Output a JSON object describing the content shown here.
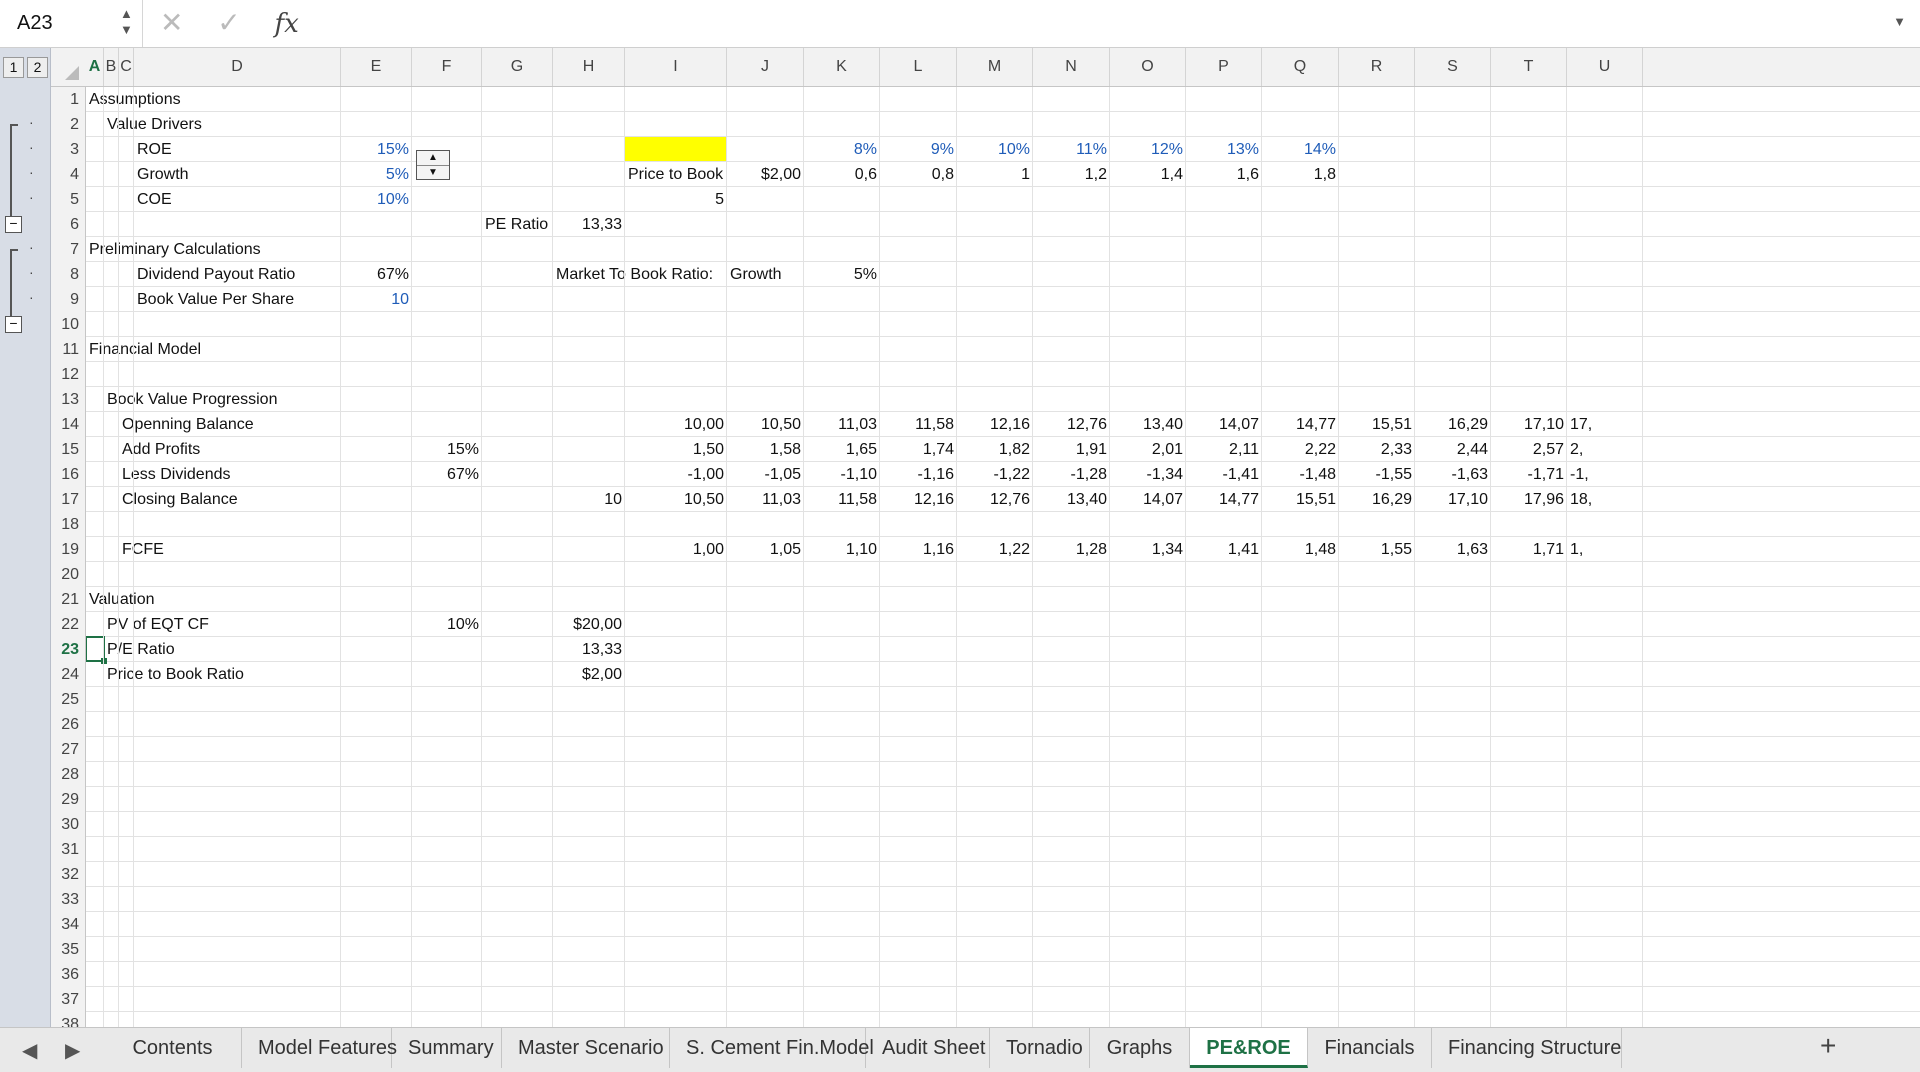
{
  "formula_bar": {
    "cell_ref": "A23",
    "cancel_icon": "✕",
    "enter_icon": "✓",
    "fx_label": "fx",
    "formula": ""
  },
  "outline": {
    "levels": [
      "1",
      "2"
    ]
  },
  "active": {
    "col": "A",
    "row": 23
  },
  "columns": [
    "A",
    "B",
    "C",
    "D",
    "E",
    "F",
    "G",
    "H",
    "I",
    "J",
    "K",
    "L",
    "M",
    "N",
    "O",
    "P",
    "Q",
    "R",
    "S",
    "T",
    "U"
  ],
  "rows": [
    1,
    2,
    3,
    4,
    5,
    6,
    7,
    8,
    9,
    10,
    11,
    12,
    13,
    14,
    15,
    16,
    17,
    18,
    19,
    20,
    21,
    22,
    23,
    24,
    25,
    26,
    27,
    28,
    29,
    30,
    31,
    32,
    33,
    34,
    35,
    36,
    37,
    38
  ],
  "cells": [
    {
      "row": 1,
      "col": "A",
      "text": "Assumptions"
    },
    {
      "row": 2,
      "col": "B",
      "text": "Value Drivers"
    },
    {
      "row": 3,
      "col": "D",
      "text": "ROE"
    },
    {
      "row": 3,
      "col": "E",
      "text": "15%",
      "align": "r",
      "color": "blue"
    },
    {
      "row": 3,
      "col": "K",
      "text": "8%",
      "align": "r",
      "color": "blue"
    },
    {
      "row": 3,
      "col": "L",
      "text": "9%",
      "align": "r",
      "color": "blue"
    },
    {
      "row": 3,
      "col": "M",
      "text": "10%",
      "align": "r",
      "color": "blue"
    },
    {
      "row": 3,
      "col": "N",
      "text": "11%",
      "align": "r",
      "color": "blue"
    },
    {
      "row": 3,
      "col": "O",
      "text": "12%",
      "align": "r",
      "color": "blue"
    },
    {
      "row": 3,
      "col": "P",
      "text": "13%",
      "align": "r",
      "color": "blue"
    },
    {
      "row": 3,
      "col": "Q",
      "text": "14%",
      "align": "r",
      "color": "blue"
    },
    {
      "row": 4,
      "col": "D",
      "text": "Growth"
    },
    {
      "row": 4,
      "col": "E",
      "text": "5%",
      "align": "r",
      "color": "blue"
    },
    {
      "row": 4,
      "col": "I",
      "text": "Price to Book"
    },
    {
      "row": 4,
      "col": "J",
      "text": "$2,00",
      "align": "r"
    },
    {
      "row": 4,
      "col": "K",
      "text": "0,6",
      "align": "r"
    },
    {
      "row": 4,
      "col": "L",
      "text": "0,8",
      "align": "r"
    },
    {
      "row": 4,
      "col": "M",
      "text": "1",
      "align": "r"
    },
    {
      "row": 4,
      "col": "N",
      "text": "1,2",
      "align": "r"
    },
    {
      "row": 4,
      "col": "O",
      "text": "1,4",
      "align": "r"
    },
    {
      "row": 4,
      "col": "P",
      "text": "1,6",
      "align": "r"
    },
    {
      "row": 4,
      "col": "Q",
      "text": "1,8",
      "align": "r"
    },
    {
      "row": 5,
      "col": "D",
      "text": "COE"
    },
    {
      "row": 5,
      "col": "E",
      "text": "10%",
      "align": "r",
      "color": "blue"
    },
    {
      "row": 5,
      "col": "I",
      "text": "5",
      "align": "r"
    },
    {
      "row": 6,
      "col": "G",
      "text": "PE Ratio"
    },
    {
      "row": 6,
      "col": "H",
      "text": "13,33",
      "align": "r"
    },
    {
      "row": 7,
      "col": "A",
      "text": "Preliminary Calculations"
    },
    {
      "row": 8,
      "col": "D",
      "text": "Dividend Payout Ratio"
    },
    {
      "row": 8,
      "col": "E",
      "text": "67%",
      "align": "r"
    },
    {
      "row": 8,
      "col": "H",
      "text": "Market To Book Ratio:"
    },
    {
      "row": 8,
      "col": "J",
      "text": "Growth"
    },
    {
      "row": 8,
      "col": "K",
      "text": "5%",
      "align": "r"
    },
    {
      "row": 9,
      "col": "D",
      "text": "Book Value Per Share"
    },
    {
      "row": 9,
      "col": "E",
      "text": "10",
      "align": "r",
      "color": "blue"
    },
    {
      "row": 11,
      "col": "A",
      "text": "Financial Model"
    },
    {
      "row": 13,
      "col": "B",
      "text": "Book Value Progression"
    },
    {
      "row": 14,
      "col": "C",
      "text": "Openning Balance"
    },
    {
      "row": 14,
      "col": "I",
      "text": "10,00",
      "align": "r"
    },
    {
      "row": 14,
      "col": "J",
      "text": "10,50",
      "align": "r"
    },
    {
      "row": 14,
      "col": "K",
      "text": "11,03",
      "align": "r"
    },
    {
      "row": 14,
      "col": "L",
      "text": "11,58",
      "align": "r"
    },
    {
      "row": 14,
      "col": "M",
      "text": "12,16",
      "align": "r"
    },
    {
      "row": 14,
      "col": "N",
      "text": "12,76",
      "align": "r"
    },
    {
      "row": 14,
      "col": "O",
      "text": "13,40",
      "align": "r"
    },
    {
      "row": 14,
      "col": "P",
      "text": "14,07",
      "align": "r"
    },
    {
      "row": 14,
      "col": "Q",
      "text": "14,77",
      "align": "r"
    },
    {
      "row": 14,
      "col": "R",
      "text": "15,51",
      "align": "r"
    },
    {
      "row": 14,
      "col": "S",
      "text": "16,29",
      "align": "r"
    },
    {
      "row": 14,
      "col": "T",
      "text": "17,10",
      "align": "r"
    },
    {
      "row": 14,
      "col": "U",
      "text": "17,"
    },
    {
      "row": 15,
      "col": "C",
      "text": "Add Profits"
    },
    {
      "row": 15,
      "col": "F",
      "text": "15%",
      "align": "r"
    },
    {
      "row": 15,
      "col": "I",
      "text": "1,50",
      "align": "r"
    },
    {
      "row": 15,
      "col": "J",
      "text": "1,58",
      "align": "r"
    },
    {
      "row": 15,
      "col": "K",
      "text": "1,65",
      "align": "r"
    },
    {
      "row": 15,
      "col": "L",
      "text": "1,74",
      "align": "r"
    },
    {
      "row": 15,
      "col": "M",
      "text": "1,82",
      "align": "r"
    },
    {
      "row": 15,
      "col": "N",
      "text": "1,91",
      "align": "r"
    },
    {
      "row": 15,
      "col": "O",
      "text": "2,01",
      "align": "r"
    },
    {
      "row": 15,
      "col": "P",
      "text": "2,11",
      "align": "r"
    },
    {
      "row": 15,
      "col": "Q",
      "text": "2,22",
      "align": "r"
    },
    {
      "row": 15,
      "col": "R",
      "text": "2,33",
      "align": "r"
    },
    {
      "row": 15,
      "col": "S",
      "text": "2,44",
      "align": "r"
    },
    {
      "row": 15,
      "col": "T",
      "text": "2,57",
      "align": "r"
    },
    {
      "row": 15,
      "col": "U",
      "text": "2,"
    },
    {
      "row": 16,
      "col": "C",
      "text": "Less Dividends"
    },
    {
      "row": 16,
      "col": "F",
      "text": "67%",
      "align": "r"
    },
    {
      "row": 16,
      "col": "I",
      "text": "-1,00",
      "align": "r"
    },
    {
      "row": 16,
      "col": "J",
      "text": "-1,05",
      "align": "r"
    },
    {
      "row": 16,
      "col": "K",
      "text": "-1,10",
      "align": "r"
    },
    {
      "row": 16,
      "col": "L",
      "text": "-1,16",
      "align": "r"
    },
    {
      "row": 16,
      "col": "M",
      "text": "-1,22",
      "align": "r"
    },
    {
      "row": 16,
      "col": "N",
      "text": "-1,28",
      "align": "r"
    },
    {
      "row": 16,
      "col": "O",
      "text": "-1,34",
      "align": "r"
    },
    {
      "row": 16,
      "col": "P",
      "text": "-1,41",
      "align": "r"
    },
    {
      "row": 16,
      "col": "Q",
      "text": "-1,48",
      "align": "r"
    },
    {
      "row": 16,
      "col": "R",
      "text": "-1,55",
      "align": "r"
    },
    {
      "row": 16,
      "col": "S",
      "text": "-1,63",
      "align": "r"
    },
    {
      "row": 16,
      "col": "T",
      "text": "-1,71",
      "align": "r"
    },
    {
      "row": 16,
      "col": "U",
      "text": "-1,"
    },
    {
      "row": 17,
      "col": "C",
      "text": "Closing Balance"
    },
    {
      "row": 17,
      "col": "H",
      "text": "10",
      "align": "r"
    },
    {
      "row": 17,
      "col": "I",
      "text": "10,50",
      "align": "r"
    },
    {
      "row": 17,
      "col": "J",
      "text": "11,03",
      "align": "r"
    },
    {
      "row": 17,
      "col": "K",
      "text": "11,58",
      "align": "r"
    },
    {
      "row": 17,
      "col": "L",
      "text": "12,16",
      "align": "r"
    },
    {
      "row": 17,
      "col": "M",
      "text": "12,76",
      "align": "r"
    },
    {
      "row": 17,
      "col": "N",
      "text": "13,40",
      "align": "r"
    },
    {
      "row": 17,
      "col": "O",
      "text": "14,07",
      "align": "r"
    },
    {
      "row": 17,
      "col": "P",
      "text": "14,77",
      "align": "r"
    },
    {
      "row": 17,
      "col": "Q",
      "text": "15,51",
      "align": "r"
    },
    {
      "row": 17,
      "col": "R",
      "text": "16,29",
      "align": "r"
    },
    {
      "row": 17,
      "col": "S",
      "text": "17,10",
      "align": "r"
    },
    {
      "row": 17,
      "col": "T",
      "text": "17,96",
      "align": "r"
    },
    {
      "row": 17,
      "col": "U",
      "text": "18,"
    },
    {
      "row": 19,
      "col": "C",
      "text": "FCFE"
    },
    {
      "row": 19,
      "col": "I",
      "text": "1,00",
      "align": "r"
    },
    {
      "row": 19,
      "col": "J",
      "text": "1,05",
      "align": "r"
    },
    {
      "row": 19,
      "col": "K",
      "text": "1,10",
      "align": "r"
    },
    {
      "row": 19,
      "col": "L",
      "text": "1,16",
      "align": "r"
    },
    {
      "row": 19,
      "col": "M",
      "text": "1,22",
      "align": "r"
    },
    {
      "row": 19,
      "col": "N",
      "text": "1,28",
      "align": "r"
    },
    {
      "row": 19,
      "col": "O",
      "text": "1,34",
      "align": "r"
    },
    {
      "row": 19,
      "col": "P",
      "text": "1,41",
      "align": "r"
    },
    {
      "row": 19,
      "col": "Q",
      "text": "1,48",
      "align": "r"
    },
    {
      "row": 19,
      "col": "R",
      "text": "1,55",
      "align": "r"
    },
    {
      "row": 19,
      "col": "S",
      "text": "1,63",
      "align": "r"
    },
    {
      "row": 19,
      "col": "T",
      "text": "1,71",
      "align": "r"
    },
    {
      "row": 19,
      "col": "U",
      "text": "1,"
    },
    {
      "row": 21,
      "col": "A",
      "text": "Valuation"
    },
    {
      "row": 22,
      "col": "B",
      "text": "PV of EQT CF"
    },
    {
      "row": 22,
      "col": "F",
      "text": "10%",
      "align": "r"
    },
    {
      "row": 22,
      "col": "H",
      "text": "$20,00",
      "align": "r"
    },
    {
      "row": 23,
      "col": "B",
      "text": "P/E Ratio"
    },
    {
      "row": 23,
      "col": "H",
      "text": "13,33",
      "align": "r"
    },
    {
      "row": 24,
      "col": "B",
      "text": "Price to Book Ratio"
    },
    {
      "row": 24,
      "col": "H",
      "text": "$2,00",
      "align": "r"
    }
  ],
  "highlight": {
    "cell": "I3",
    "color": "#ffff00"
  },
  "accent_color": "#1e7145",
  "input_color": "#1f5cb8",
  "sheet_tabs": [
    "Contents",
    "Model Features",
    "Summary",
    "Master Scenario",
    "S. Cement Fin.Model",
    "Audit Sheet",
    "Tornadio",
    "Graphs",
    "PE&ROE",
    "Financials",
    "Financing Structure"
  ],
  "active_sheet": "PE&ROE",
  "tab_nav": {
    "prev_icon": "◀",
    "next_icon": "▶",
    "add_icon": "+"
  }
}
